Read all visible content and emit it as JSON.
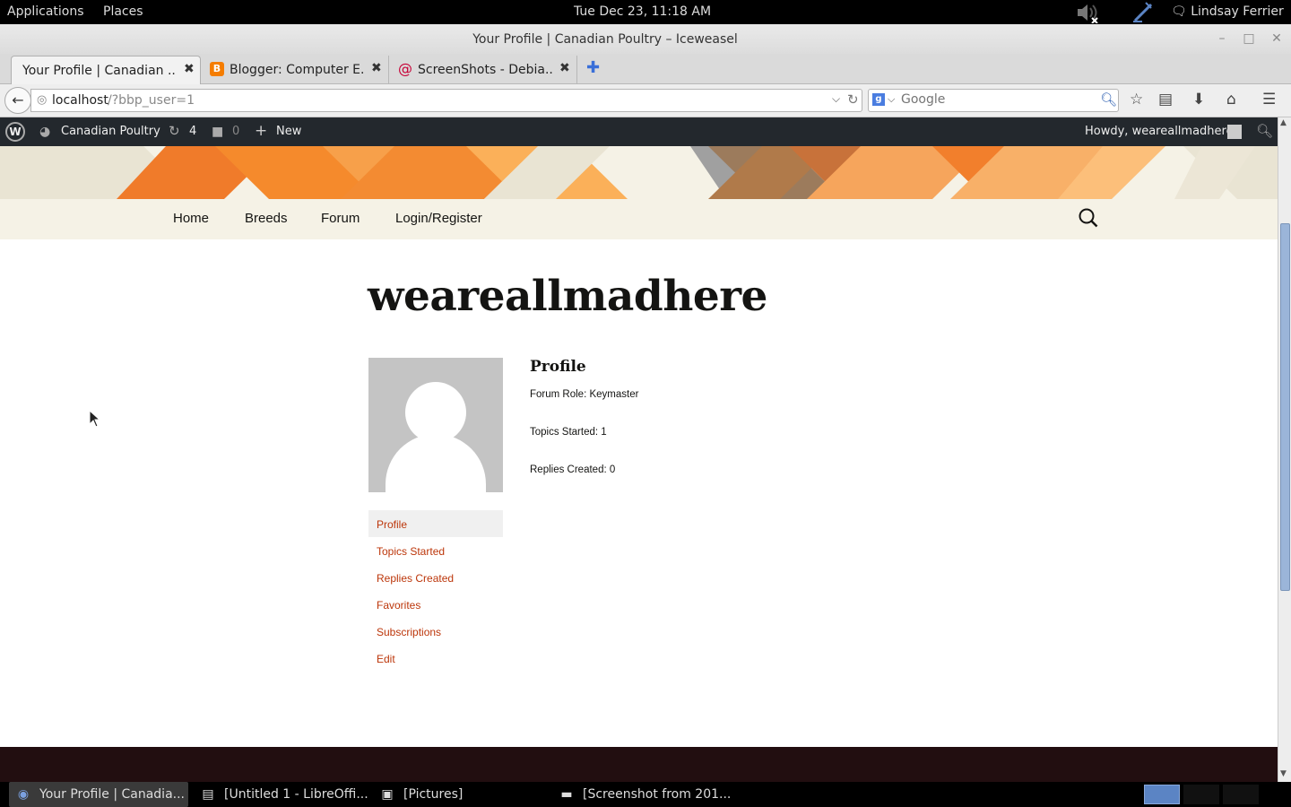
{
  "panel": {
    "applications": "Applications",
    "places": "Places",
    "clock": "Tue Dec 23, 11:18 AM",
    "user": "Lindsay Ferrier"
  },
  "window": {
    "title": "Your Profile | Canadian Poultry – Iceweasel"
  },
  "tabs": [
    {
      "label": "Your Profile | Canadian ..."
    },
    {
      "label": "Blogger: Computer E..."
    },
    {
      "label": "ScreenShots - Debia..."
    }
  ],
  "navbar": {
    "url_host": "localhost",
    "url_path": "/?bbp_user=1",
    "search_placeholder": "Google"
  },
  "adminbar": {
    "site_name": "Canadian Poultry",
    "updates": "4",
    "comments": "0",
    "new_label": "New",
    "howdy": "Howdy, weareallmadhere"
  },
  "site_nav": {
    "items": [
      "Home",
      "Breeds",
      "Forum",
      "Login/Register"
    ]
  },
  "profile": {
    "username": "weareallmadhere",
    "heading": "Profile",
    "forum_role": "Forum Role: Keymaster",
    "topics_started": "Topics Started: 1",
    "replies_created": "Replies Created: 0",
    "menu": [
      "Profile",
      "Topics Started",
      "Replies Created",
      "Favorites",
      "Subscriptions",
      "Edit"
    ]
  },
  "taskbar": {
    "tasks": [
      "Your Profile | Canadia...",
      "[Untitled 1 - LibreOffi...",
      "[Pictures]",
      "[Screenshot from 201..."
    ]
  },
  "colors": {
    "link": "#bc360a",
    "adminbar": "#23282d",
    "banner_bg": "#f5f2e6",
    "footer": "#220e10"
  }
}
